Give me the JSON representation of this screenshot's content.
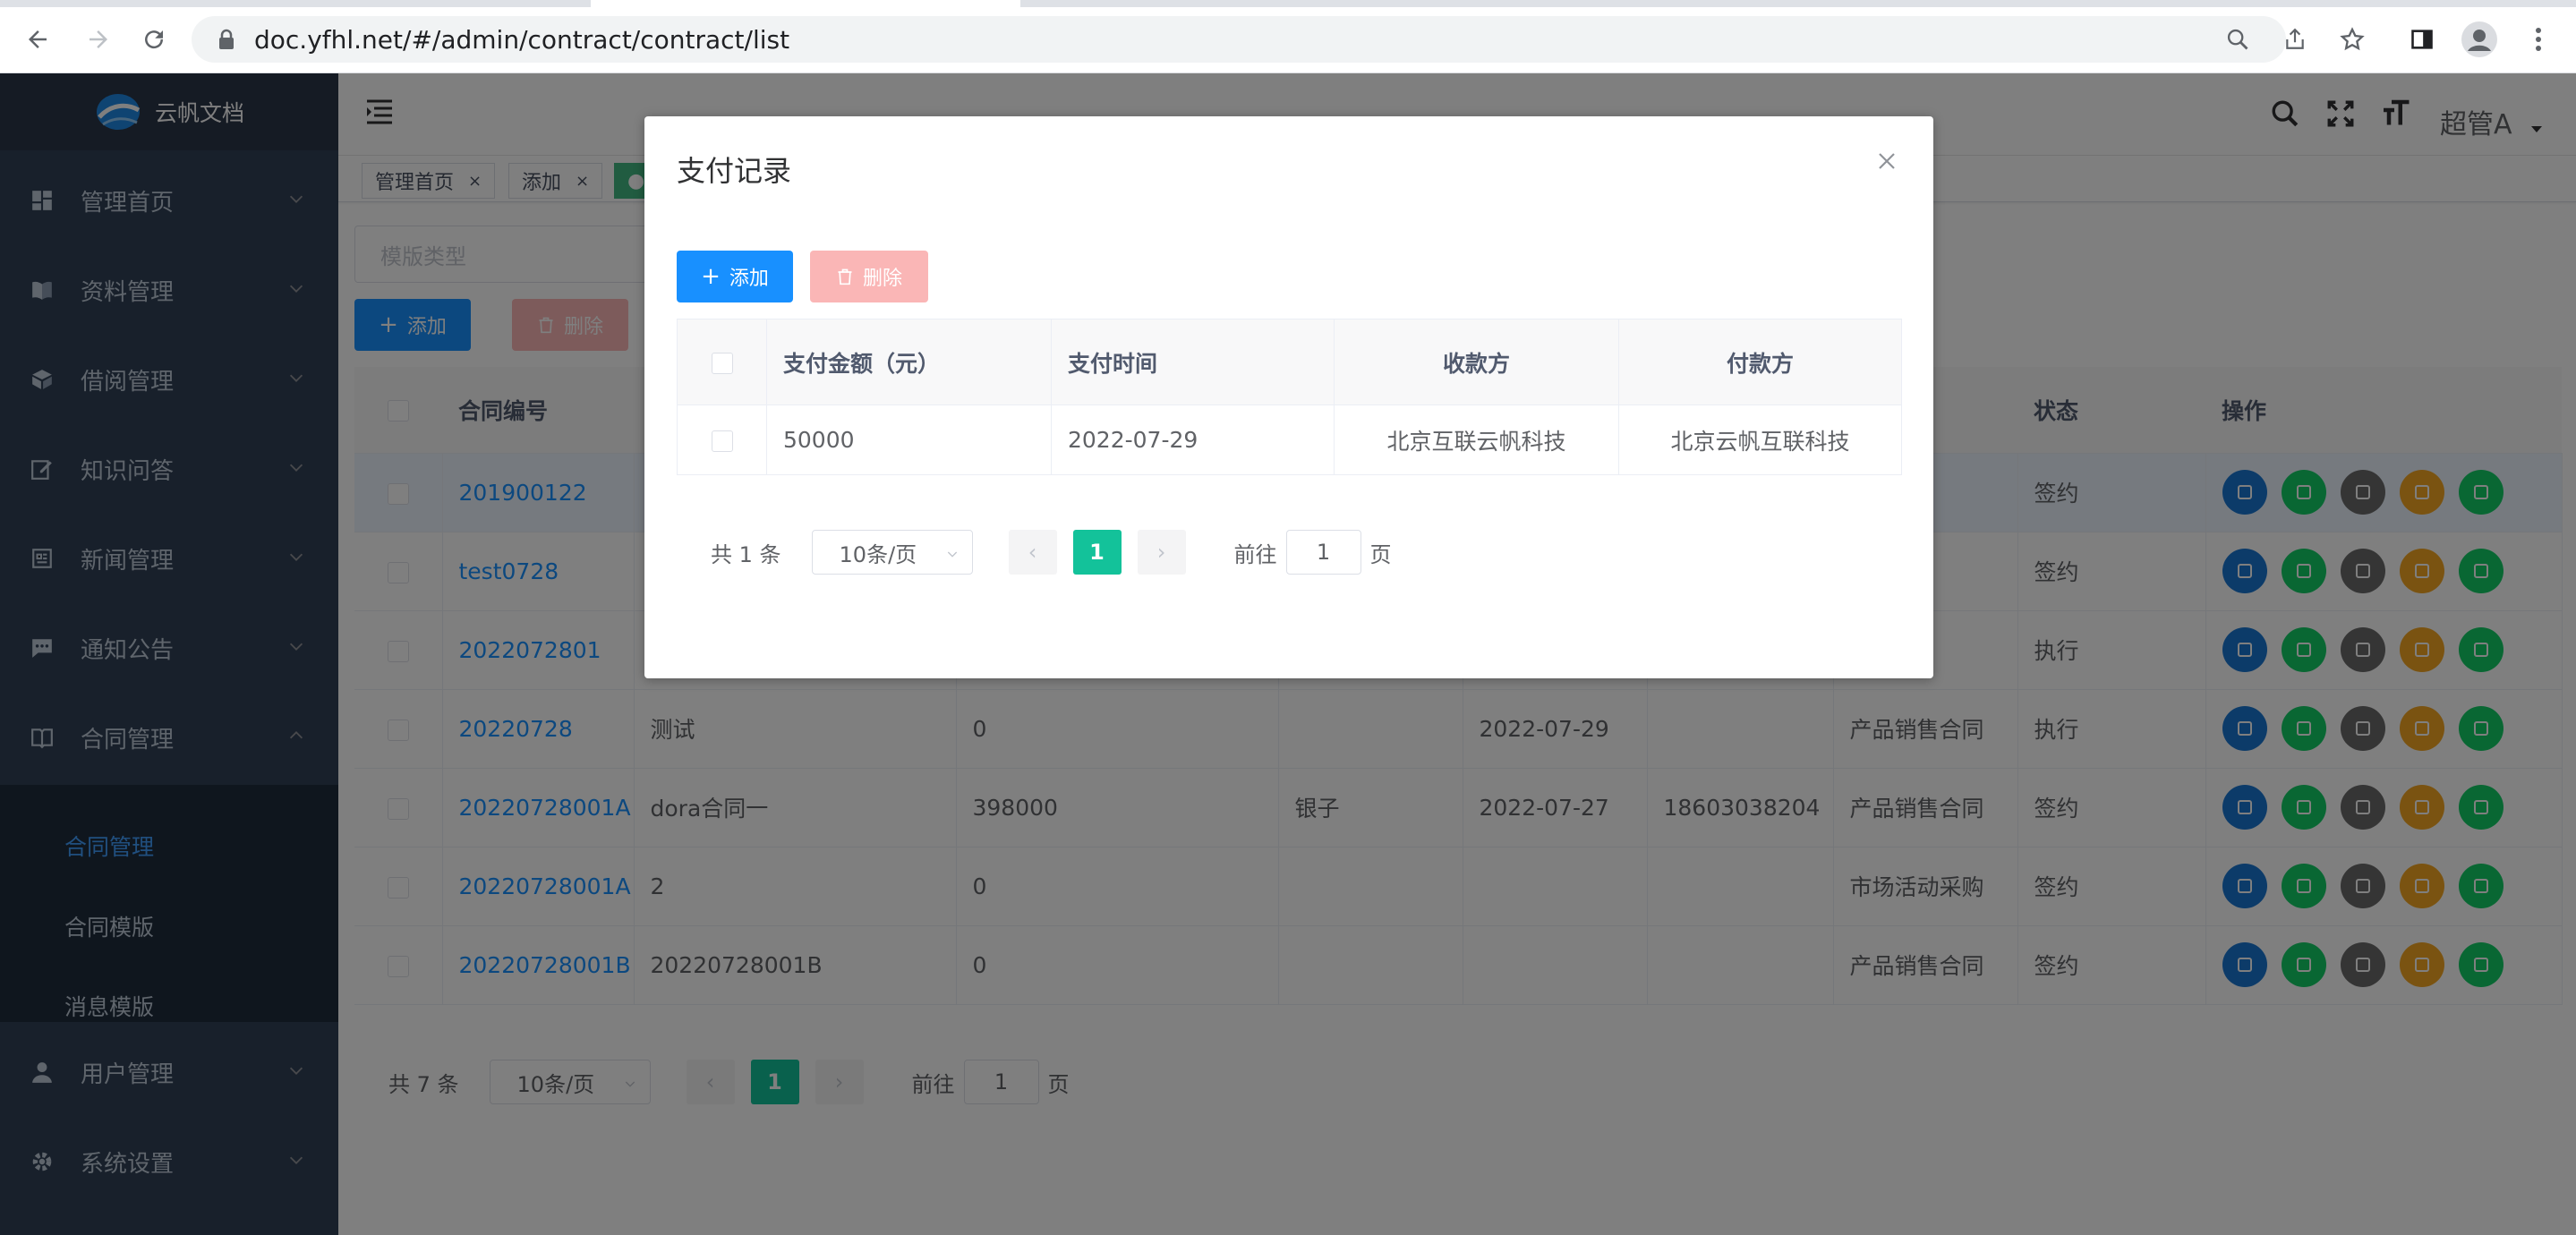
{
  "browser": {
    "url": "doc.yfhl.net/#/admin/contract/contract/list"
  },
  "app": {
    "logo_text": "云帆文档",
    "user_name": "超管A"
  },
  "sidebar": {
    "items": [
      {
        "label": "管理首页",
        "icon": "dashboard-icon"
      },
      {
        "label": "资料管理",
        "icon": "book-icon"
      },
      {
        "label": "借阅管理",
        "icon": "box-icon"
      },
      {
        "label": "知识问答",
        "icon": "edit-icon"
      },
      {
        "label": "新闻管理",
        "icon": "news-icon"
      },
      {
        "label": "通知公告",
        "icon": "message-icon"
      },
      {
        "label": "合同管理",
        "icon": "contract-icon"
      },
      {
        "label": "用户管理",
        "icon": "user-icon"
      },
      {
        "label": "系统设置",
        "icon": "gear-icon"
      }
    ],
    "submenu": [
      {
        "label": "合同管理",
        "active": true
      },
      {
        "label": "合同模版",
        "active": false
      },
      {
        "label": "消息模版",
        "active": false
      }
    ]
  },
  "tags": [
    {
      "label": "管理首页",
      "close": "×"
    },
    {
      "label": "添加",
      "close": "×"
    },
    {
      "label": "●",
      "close": ""
    }
  ],
  "filters": {
    "template_type_placeholder": "模版类型"
  },
  "toolbar": {
    "add_label": "添加",
    "delete_label": "删除"
  },
  "contract_table": {
    "headers": {
      "no": "合同编号",
      "type_tail": "型",
      "status": "状态",
      "actions": "操作"
    },
    "rows": [
      {
        "no": "201900122",
        "name": "",
        "amount": "",
        "party": "",
        "date": "",
        "phone": "",
        "type": "同",
        "status": "签约"
      },
      {
        "no": "test0728",
        "name": "",
        "amount": "",
        "party": "",
        "date": "",
        "phone": "",
        "type": "售合同",
        "status": "签约"
      },
      {
        "no": "2022072801",
        "name": "",
        "amount": "",
        "party": "",
        "date": "",
        "phone": "",
        "type": "售合同",
        "status": "执行"
      },
      {
        "no": "20220728",
        "name": "测试",
        "amount": "0",
        "party": "",
        "date": "2022-07-29",
        "phone": "",
        "type": "产品销售合同",
        "status": "执行"
      },
      {
        "no": "20220728001A",
        "name": "dora合同一",
        "amount": "398000",
        "party": "银子",
        "date": "2022-07-27",
        "phone": "18603038204",
        "type": "产品销售合同",
        "status": "签约"
      },
      {
        "no": "20220728001A",
        "name": "2",
        "amount": "0",
        "party": "",
        "date": "",
        "phone": "",
        "type": "市场活动采购",
        "status": "签约"
      },
      {
        "no": "20220728001B",
        "name": "20220728001B",
        "amount": "0",
        "party": "",
        "date": "",
        "phone": "",
        "type": "产品销售合同",
        "status": "签约"
      }
    ],
    "action_colors": [
      "#1976d2",
      "#13ce66",
      "#6b6b6b",
      "#f5a623",
      "#13ce66"
    ]
  },
  "pagination": {
    "total": "共 7 条",
    "page_size": "10条/页",
    "current": "1",
    "goto_prefix": "前往",
    "goto_value": "1",
    "goto_suffix": "页"
  },
  "dialog": {
    "title": "支付记录",
    "add_label": "添加",
    "delete_label": "删除",
    "headers": {
      "amount": "支付金额（元）",
      "time": "支付时间",
      "payee": "收款方",
      "payer": "付款方"
    },
    "rows": [
      {
        "amount": "50000",
        "time": "2022-07-29",
        "payee": "北京互联云帆科技",
        "payer": "北京云帆互联科技"
      }
    ],
    "pagination": {
      "total": "共 1 条",
      "page_size": "10条/页",
      "current": "1",
      "goto_prefix": "前往",
      "goto_value": "1",
      "goto_suffix": "页"
    }
  }
}
